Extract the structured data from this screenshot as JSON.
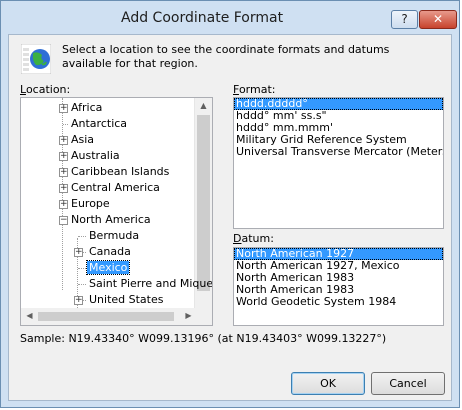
{
  "window": {
    "title": "Add Coordinate Format",
    "help_label": "?",
    "close_label": "✕"
  },
  "intro": "Select a location to see the coordinate formats and datums available for that region.",
  "location_label": "Location:",
  "location_label_key": "L",
  "location_label_rest": "ocation:",
  "tree": {
    "items": [
      {
        "label": "Africa",
        "expander": "+",
        "level": 0
      },
      {
        "label": "Antarctica",
        "expander": "",
        "level": 0
      },
      {
        "label": "Asia",
        "expander": "+",
        "level": 0
      },
      {
        "label": "Australia",
        "expander": "+",
        "level": 0
      },
      {
        "label": "Caribbean Islands",
        "expander": "+",
        "level": 0
      },
      {
        "label": "Central America",
        "expander": "+",
        "level": 0
      },
      {
        "label": "Europe",
        "expander": "+",
        "level": 0
      },
      {
        "label": "North America",
        "expander": "−",
        "level": 0
      },
      {
        "label": "Bermuda",
        "expander": "",
        "level": 1
      },
      {
        "label": "Canada",
        "expander": "+",
        "level": 1
      },
      {
        "label": "Mexico",
        "expander": "",
        "level": 1,
        "selected": true
      },
      {
        "label": "Saint Pierre and Miquelon",
        "expander": "",
        "level": 1
      },
      {
        "label": "United States",
        "expander": "+",
        "level": 1
      }
    ]
  },
  "format_label_key": "F",
  "format_label_rest": "ormat:",
  "formats": [
    {
      "label": "hddd.ddddd°",
      "selected": true
    },
    {
      "label": "hddd° mm' ss.s\"",
      "selected": false
    },
    {
      "label": "hddd° mm.mmm'",
      "selected": false
    },
    {
      "label": "Military Grid Reference System",
      "selected": false
    },
    {
      "label": "Universal Transverse Mercator (Meters)",
      "selected": false
    }
  ],
  "datum_label_key": "D",
  "datum_label_rest": "atum:",
  "datums": [
    {
      "label": "North American 1927",
      "selected": true
    },
    {
      "label": "North American 1927, Mexico",
      "selected": false
    },
    {
      "label": "North American 1983",
      "selected": false
    },
    {
      "label": "North American 1983",
      "selected": false
    },
    {
      "label": "World Geodetic System 1984",
      "selected": false
    }
  ],
  "sample": "Sample: N19.43340°  W099.13196° (at N19.43403°  W099.13227°)",
  "buttons": {
    "ok": "OK",
    "cancel": "Cancel"
  },
  "colors": {
    "selection": "#3399ff",
    "title_bar": "#cfe0f2",
    "close_button": "#c7432d"
  },
  "icons": {
    "app": "globe-icon",
    "expand": "plus-box-icon",
    "collapse": "minus-box-icon"
  }
}
